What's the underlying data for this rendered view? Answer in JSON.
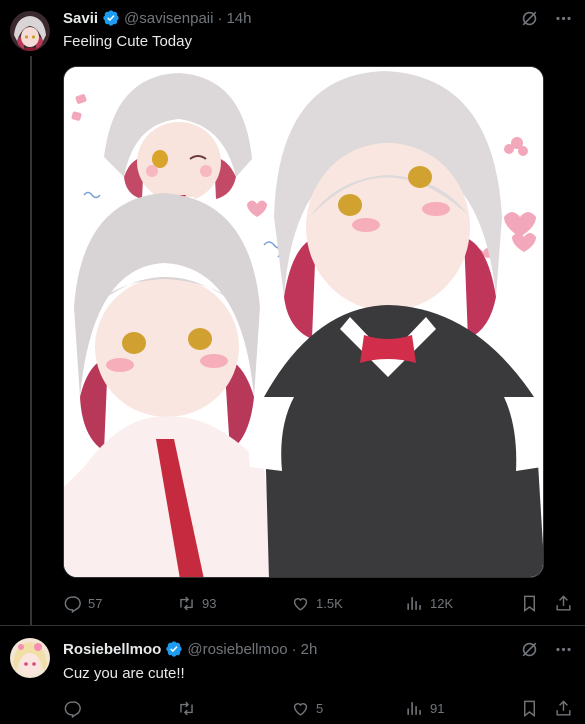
{
  "post": {
    "author": {
      "name": "Savii",
      "handle": "@savisenpaii",
      "time": "14h"
    },
    "text": "Feeling Cute Today",
    "media": {
      "alt": "Anime illustration of a silver-and-pink haired girl in a school uniform"
    },
    "stats": {
      "replies": "57",
      "reposts": "93",
      "likes": "1.5K",
      "views": "12K"
    }
  },
  "reply": {
    "author": {
      "name": "Rosiebellmoo",
      "handle": "@rosiebellmoo",
      "time": "2h"
    },
    "text": "Cuz you are cute!!",
    "stats": {
      "replies": "",
      "reposts": "",
      "likes": "5",
      "views": "91"
    }
  },
  "colors": {
    "verified": "#1d9bf0",
    "muted": "#71767b",
    "text": "#e7e9ea",
    "background": "#000000"
  },
  "icons": [
    "verified-badge-icon",
    "grok-icon",
    "more-icon",
    "reply-icon",
    "repost-icon",
    "like-icon",
    "views-icon",
    "bookmark-icon",
    "share-icon"
  ]
}
